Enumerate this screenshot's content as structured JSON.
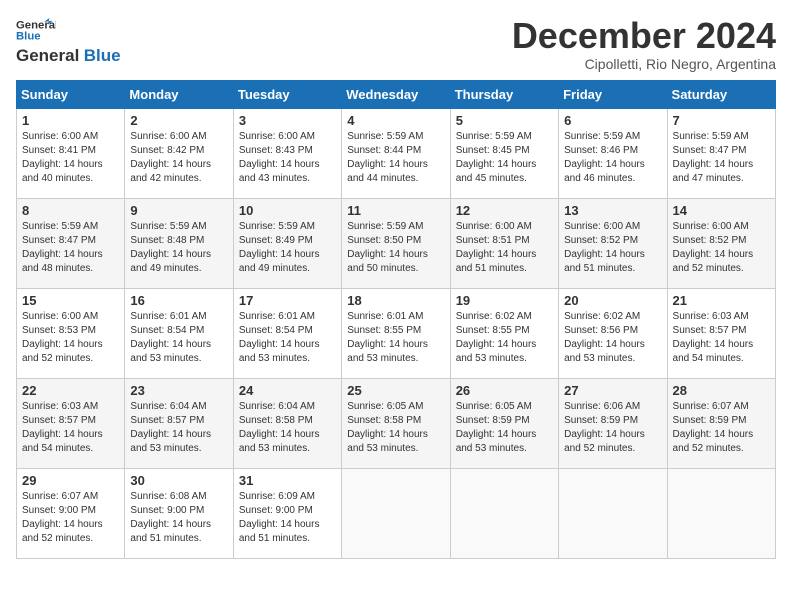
{
  "header": {
    "logo_line1": "General",
    "logo_line2": "Blue",
    "month": "December 2024",
    "location": "Cipolletti, Rio Negro, Argentina"
  },
  "weekdays": [
    "Sunday",
    "Monday",
    "Tuesday",
    "Wednesday",
    "Thursday",
    "Friday",
    "Saturday"
  ],
  "weeks": [
    [
      {
        "day": "1",
        "info": "Sunrise: 6:00 AM\nSunset: 8:41 PM\nDaylight: 14 hours\nand 40 minutes."
      },
      {
        "day": "2",
        "info": "Sunrise: 6:00 AM\nSunset: 8:42 PM\nDaylight: 14 hours\nand 42 minutes."
      },
      {
        "day": "3",
        "info": "Sunrise: 6:00 AM\nSunset: 8:43 PM\nDaylight: 14 hours\nand 43 minutes."
      },
      {
        "day": "4",
        "info": "Sunrise: 5:59 AM\nSunset: 8:44 PM\nDaylight: 14 hours\nand 44 minutes."
      },
      {
        "day": "5",
        "info": "Sunrise: 5:59 AM\nSunset: 8:45 PM\nDaylight: 14 hours\nand 45 minutes."
      },
      {
        "day": "6",
        "info": "Sunrise: 5:59 AM\nSunset: 8:46 PM\nDaylight: 14 hours\nand 46 minutes."
      },
      {
        "day": "7",
        "info": "Sunrise: 5:59 AM\nSunset: 8:47 PM\nDaylight: 14 hours\nand 47 minutes."
      }
    ],
    [
      {
        "day": "8",
        "info": "Sunrise: 5:59 AM\nSunset: 8:47 PM\nDaylight: 14 hours\nand 48 minutes."
      },
      {
        "day": "9",
        "info": "Sunrise: 5:59 AM\nSunset: 8:48 PM\nDaylight: 14 hours\nand 49 minutes."
      },
      {
        "day": "10",
        "info": "Sunrise: 5:59 AM\nSunset: 8:49 PM\nDaylight: 14 hours\nand 49 minutes."
      },
      {
        "day": "11",
        "info": "Sunrise: 5:59 AM\nSunset: 8:50 PM\nDaylight: 14 hours\nand 50 minutes."
      },
      {
        "day": "12",
        "info": "Sunrise: 6:00 AM\nSunset: 8:51 PM\nDaylight: 14 hours\nand 51 minutes."
      },
      {
        "day": "13",
        "info": "Sunrise: 6:00 AM\nSunset: 8:52 PM\nDaylight: 14 hours\nand 51 minutes."
      },
      {
        "day": "14",
        "info": "Sunrise: 6:00 AM\nSunset: 8:52 PM\nDaylight: 14 hours\nand 52 minutes."
      }
    ],
    [
      {
        "day": "15",
        "info": "Sunrise: 6:00 AM\nSunset: 8:53 PM\nDaylight: 14 hours\nand 52 minutes."
      },
      {
        "day": "16",
        "info": "Sunrise: 6:01 AM\nSunset: 8:54 PM\nDaylight: 14 hours\nand 53 minutes."
      },
      {
        "day": "17",
        "info": "Sunrise: 6:01 AM\nSunset: 8:54 PM\nDaylight: 14 hours\nand 53 minutes."
      },
      {
        "day": "18",
        "info": "Sunrise: 6:01 AM\nSunset: 8:55 PM\nDaylight: 14 hours\nand 53 minutes."
      },
      {
        "day": "19",
        "info": "Sunrise: 6:02 AM\nSunset: 8:55 PM\nDaylight: 14 hours\nand 53 minutes."
      },
      {
        "day": "20",
        "info": "Sunrise: 6:02 AM\nSunset: 8:56 PM\nDaylight: 14 hours\nand 53 minutes."
      },
      {
        "day": "21",
        "info": "Sunrise: 6:03 AM\nSunset: 8:57 PM\nDaylight: 14 hours\nand 54 minutes."
      }
    ],
    [
      {
        "day": "22",
        "info": "Sunrise: 6:03 AM\nSunset: 8:57 PM\nDaylight: 14 hours\nand 54 minutes."
      },
      {
        "day": "23",
        "info": "Sunrise: 6:04 AM\nSunset: 8:57 PM\nDaylight: 14 hours\nand 53 minutes."
      },
      {
        "day": "24",
        "info": "Sunrise: 6:04 AM\nSunset: 8:58 PM\nDaylight: 14 hours\nand 53 minutes."
      },
      {
        "day": "25",
        "info": "Sunrise: 6:05 AM\nSunset: 8:58 PM\nDaylight: 14 hours\nand 53 minutes."
      },
      {
        "day": "26",
        "info": "Sunrise: 6:05 AM\nSunset: 8:59 PM\nDaylight: 14 hours\nand 53 minutes."
      },
      {
        "day": "27",
        "info": "Sunrise: 6:06 AM\nSunset: 8:59 PM\nDaylight: 14 hours\nand 52 minutes."
      },
      {
        "day": "28",
        "info": "Sunrise: 6:07 AM\nSunset: 8:59 PM\nDaylight: 14 hours\nand 52 minutes."
      }
    ],
    [
      {
        "day": "29",
        "info": "Sunrise: 6:07 AM\nSunset: 9:00 PM\nDaylight: 14 hours\nand 52 minutes."
      },
      {
        "day": "30",
        "info": "Sunrise: 6:08 AM\nSunset: 9:00 PM\nDaylight: 14 hours\nand 51 minutes."
      },
      {
        "day": "31",
        "info": "Sunrise: 6:09 AM\nSunset: 9:00 PM\nDaylight: 14 hours\nand 51 minutes."
      },
      {
        "day": "",
        "info": ""
      },
      {
        "day": "",
        "info": ""
      },
      {
        "day": "",
        "info": ""
      },
      {
        "day": "",
        "info": ""
      }
    ]
  ]
}
